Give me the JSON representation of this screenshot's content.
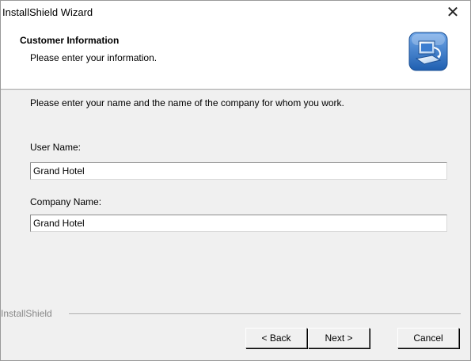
{
  "window": {
    "title": "InstallShield Wizard",
    "close_glyph": "✕"
  },
  "header": {
    "title": "Customer Information",
    "subtitle": "Please enter your information.",
    "logo_icon": "computer-install-icon"
  },
  "main": {
    "intro": "Please enter your name and the name of the company for whom you work.",
    "user_name_label": "User Name:",
    "user_name_value": "Grand Hotel",
    "company_name_label": "Company Name:",
    "company_name_value": "Grand Hotel"
  },
  "footer": {
    "brand": "InstallShield",
    "back_label": "< Back",
    "next_label": "Next >",
    "cancel_label": "Cancel"
  },
  "colors": {
    "accent_blue": "#2d6fc4"
  }
}
